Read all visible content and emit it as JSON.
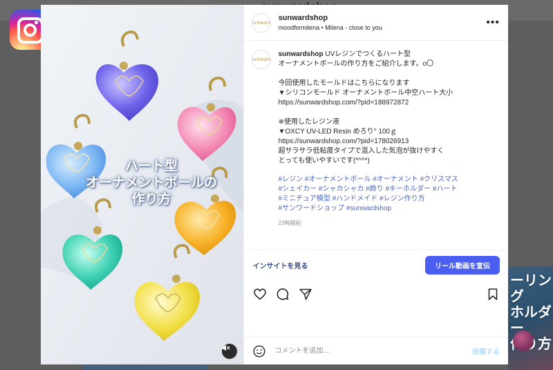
{
  "background": {
    "title": "sunwardshop",
    "right_banner": [
      "ーリング",
      "ホルダー",
      "作り方"
    ]
  },
  "post": {
    "header": {
      "username": "sunwardshop",
      "subline": "moodformilena • Milena - close to you",
      "avatar_icon": "sunward-logo-icon",
      "avatar_text": "Sunward",
      "more_icon": "more-options-icon",
      "more_label": "•••"
    },
    "media": {
      "overlay_lines": [
        "ハート型",
        "オーナメントボールの",
        "作り方"
      ],
      "mute_icon": "audio-muted-icon"
    },
    "caption": {
      "username": "sunwardshop",
      "lines": [
        "UVレジンでつくるハート型",
        "オーナメントボールの作り方をご紹介します。o〇",
        "",
        "今回使用したモールドはこちらになります",
        "▼シリコンモールド オーナメントボール中空ハート大小",
        "https://sunwardshop.com/?pid=188972872",
        "",
        "※使用したレジン液",
        "▼OXCY UV-LED Resin めろり° 100ｇ",
        "https://sunwardshop.com/?pid=178026913",
        "超サラサラ低粘度タイプで混入した気泡が抜けやすく",
        "とっても使いやすいです(*^^*)"
      ],
      "hashtag_lines": [
        "#レジン #オーナメントボール #オーナメント #クリスマス",
        "#シェイカー #シャカシャカ #飾り #キーホルダー #ハート",
        "#ミニチュア模型 #ハンドメイド #レジン作り方",
        "#サンワードショップ #sunwardshop"
      ],
      "time": "23時間前"
    },
    "insight_link": "インサイトを見る",
    "boost_button": "リール動画を宣伝",
    "actions": {
      "like_icon": "heart-icon",
      "comment_icon": "comment-icon",
      "share_icon": "share-icon",
      "save_icon": "bookmark-icon"
    },
    "comment": {
      "emoji_icon": "emoji-icon",
      "placeholder": "コメントを追加...",
      "post_label": "投稿する"
    }
  },
  "colors": {
    "accent": "#4a5ff0",
    "hashtag": "#4a66c4",
    "link": "#385185"
  }
}
